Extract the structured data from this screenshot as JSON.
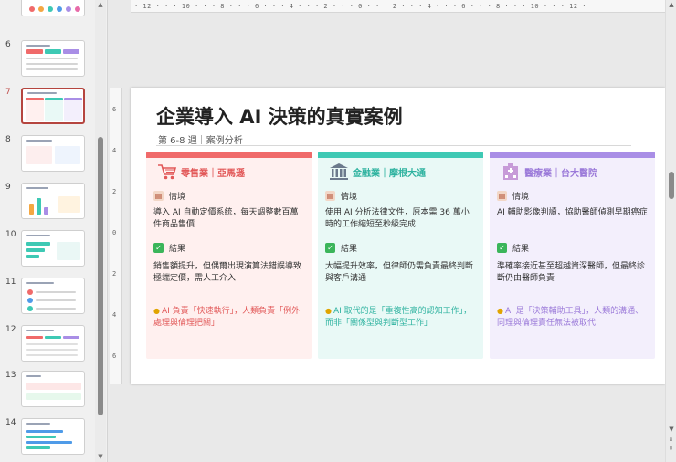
{
  "thumbnails": [
    {
      "number": "6",
      "active": false
    },
    {
      "number": "7",
      "active": true
    },
    {
      "number": "8",
      "active": false
    },
    {
      "number": "9",
      "active": false
    },
    {
      "number": "10",
      "active": false
    },
    {
      "number": "11",
      "active": false
    },
    {
      "number": "12",
      "active": false
    },
    {
      "number": "13",
      "active": false
    },
    {
      "number": "14",
      "active": false
    }
  ],
  "ruler": {
    "horizontal": "· 12 · · · 10 · · · 8 · · · 6 · · · 4 · · · 2 · · · 0 · · · 2 · · · 4 · · · 6 · · · 8 · · · 10 · · · 12 ·",
    "vertical": [
      "6",
      "4",
      "2",
      "0",
      "2",
      "4",
      "6"
    ]
  },
  "slide": {
    "title": "企業導入 AI 決策的真實案例",
    "subtitle": "第 6-8 週｜案例分析",
    "cards": [
      {
        "header": "零售業｜亞馬遜",
        "icon": "shopping-cart-icon",
        "accent": "#f06a6a",
        "bg": "#fff0ef",
        "situation_label": "情境",
        "situation": "導入 AI 自動定價系統，每天調整數百萬件商品售價",
        "result_label": "結果",
        "result": "銷售額提升，但偶爾出現演算法錯誤導致極端定價，需人工介入",
        "note": "AI 負責「快速執行」，人類負責「例外處理與倫理把關」"
      },
      {
        "header": "金融業｜摩根大通",
        "icon": "bank-icon",
        "accent": "#3ec9b4",
        "bg": "#e9f9f6",
        "situation_label": "情境",
        "situation": "使用 AI 分析法律文件，原本需 36 萬小時的工作縮短至秒級完成",
        "result_label": "結果",
        "result": "大幅提升效率，但律師仍需負責最終判斷與客戶溝通",
        "note": "AI 取代的是「重複性高的認知工作」，而非「關係型與判斷型工作」"
      },
      {
        "header": "醫療業｜台大醫院",
        "icon": "hospital-icon",
        "accent": "#a98ee6",
        "bg": "#f3effc",
        "situation_label": "情境",
        "situation": "AI 輔助影像判讀，協助醫師偵測早期癌症",
        "result_label": "結果",
        "result": "準確率接近甚至超越資深醫師，但最終診斷仍由醫師負責",
        "note": "AI 是「決策輔助工具」，人類的溝通、同理與倫理責任無法被取代"
      }
    ]
  }
}
